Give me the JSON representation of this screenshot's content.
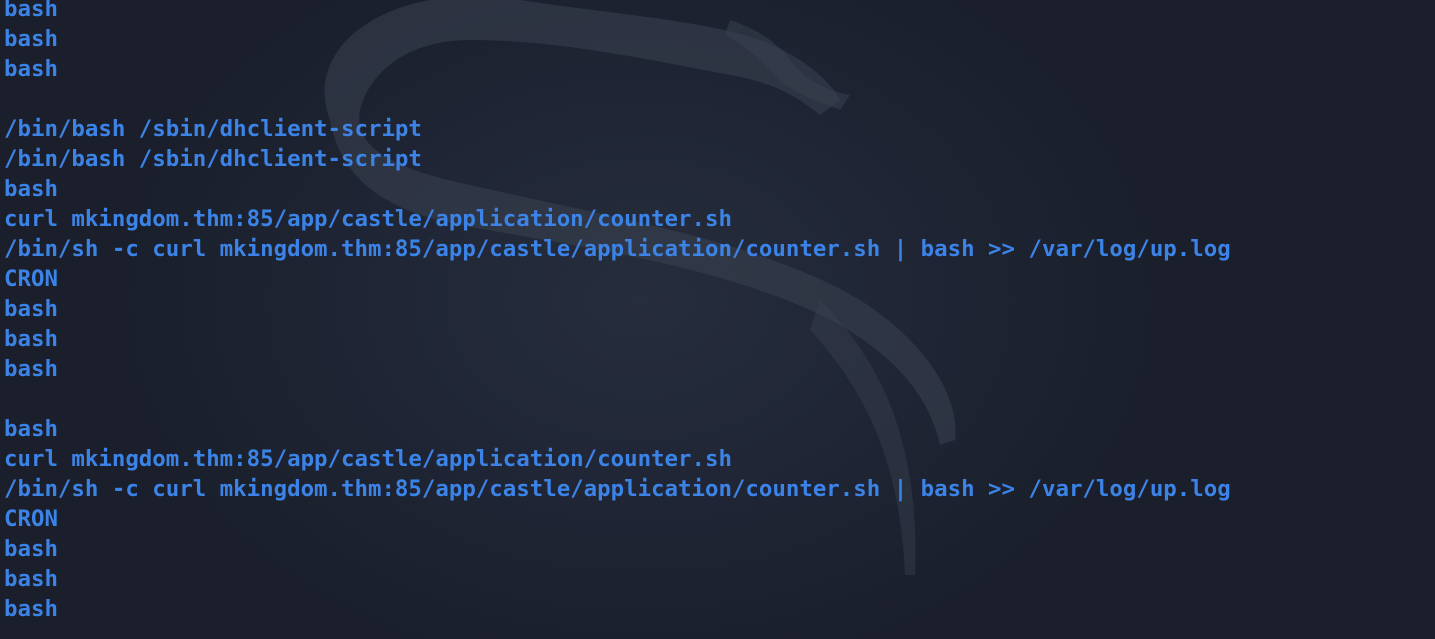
{
  "terminal": {
    "text_color": "#3c83e8",
    "background_color": "#1f2534",
    "wallpaper_icon": "kali-dragon-icon",
    "lines": [
      "bash",
      "bash",
      "bash",
      "",
      "/bin/bash /sbin/dhclient-script",
      "/bin/bash /sbin/dhclient-script",
      "bash",
      "curl mkingdom.thm:85/app/castle/application/counter.sh",
      "/bin/sh -c curl mkingdom.thm:85/app/castle/application/counter.sh | bash >> /var/log/up.log",
      "CRON",
      "bash",
      "bash",
      "bash",
      "",
      "bash",
      "curl mkingdom.thm:85/app/castle/application/counter.sh",
      "/bin/sh -c curl mkingdom.thm:85/app/castle/application/counter.sh | bash >> /var/log/up.log",
      "CRON",
      "bash",
      "bash",
      "bash"
    ]
  }
}
